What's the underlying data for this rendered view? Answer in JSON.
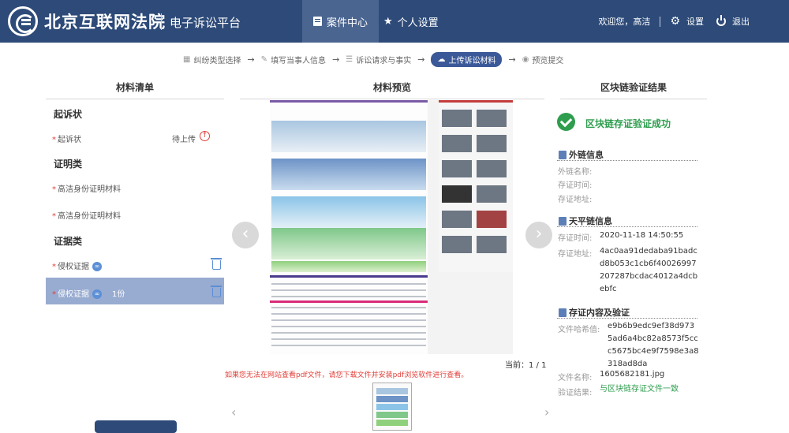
{
  "header": {
    "court_name": "北京互联网法院",
    "platform_name": "电子诉讼平台",
    "nav": [
      {
        "label": "案件中心",
        "icon": "document-icon",
        "active": true
      },
      {
        "label": "个人设置",
        "icon": "star-icon",
        "active": false
      }
    ],
    "welcome": "欢迎您，高洁",
    "settings_label": "设置",
    "logout_label": "退出",
    "colors": {
      "bar": "#2d4a78",
      "active_tab": "#4a6590"
    }
  },
  "steps": [
    {
      "label": "纠纷类型选择",
      "icon": "grid-icon",
      "current": false
    },
    {
      "label": "填写当事人信息",
      "icon": "pen-icon",
      "current": false
    },
    {
      "label": "诉讼请求与事实",
      "icon": "list-icon",
      "current": false
    },
    {
      "label": "上传诉讼材料",
      "icon": "cloud-upload-icon",
      "current": true
    },
    {
      "label": "预览提交",
      "icon": "eye-icon",
      "current": false
    }
  ],
  "materials": {
    "heading": "材料清单",
    "sections": [
      {
        "title": "起诉状",
        "items": [
          {
            "label": "起诉状",
            "required": true,
            "status": "待上传"
          }
        ]
      },
      {
        "title": "证明类",
        "items": [
          {
            "label": "高洁身份证明材料",
            "required": true
          },
          {
            "label": "高洁身份证明材料",
            "required": true
          }
        ]
      },
      {
        "title": "证据类",
        "items": [
          {
            "label": "侵权证据",
            "required": true
          },
          {
            "label": "侵权证据",
            "required": true,
            "quantity": "1份",
            "selected": true
          }
        ]
      }
    ]
  },
  "preview": {
    "heading": "材料预览",
    "page_indicator": "当前：1 / 1",
    "warning": "如果您无法在网站查看pdf文件，请您下载文件并安装pdf浏览软件进行查看。"
  },
  "blockchain": {
    "heading": "区块链验证结果",
    "success": "区块链存证验证成功",
    "external": {
      "title": "外链信息",
      "name_label": "外链名称:",
      "time_label": "存证时间:",
      "address_label": "存证地址:"
    },
    "tianping": {
      "title": "天平链信息",
      "time_label": "存证时间:",
      "time": "2020-11-18 14:50:55",
      "address_label": "存证地址:",
      "address": [
        "4ac0aa91dedaba91badc",
        "d8b053c1cb6f40026997",
        "207287bcdac4012a4dcb",
        "ebfc"
      ]
    },
    "content": {
      "title": "存证内容及验证",
      "hash_label": "文件哈希值:",
      "hash": [
        "e9b6b9edc9ef38d973",
        "5ad6a4bc82a8573f5cc",
        "c5675bc4e9f7598e3a8",
        "318ad8da"
      ],
      "filename_label": "文件名称:",
      "filename": "1605682181.jpg",
      "result_label": "验证结果:",
      "result": "与区块链存证文件一致"
    },
    "colors": {
      "success": "#2e9d4e"
    }
  }
}
